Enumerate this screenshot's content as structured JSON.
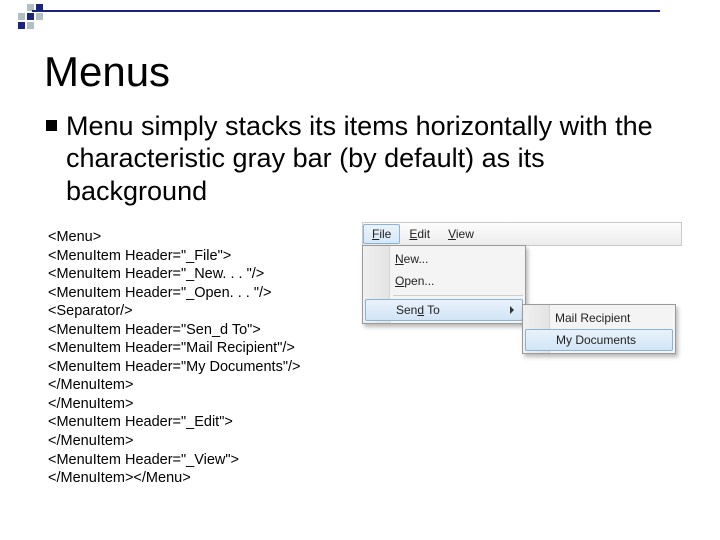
{
  "title": "Menus",
  "bullet_text": "Menu simply stacks its items horizontally with the characteristic gray bar (by default) as its background",
  "code": "<Menu>\n<MenuItem Header=\"_File\">\n<MenuItem Header=\"_New. . . \"/>\n<MenuItem Header=\"_Open. . . \"/>\n<Separator/>\n<MenuItem Header=\"Sen_d To\">\n<MenuItem Header=\"Mail Recipient\"/>\n<MenuItem Header=\"My Documents\"/>\n</MenuItem>\n</MenuItem>\n<MenuItem Header=\"_Edit\">\n</MenuItem>\n<MenuItem Header=\"_View\">\n</MenuItem></Menu>",
  "menubar": {
    "file": "File",
    "edit": "Edit",
    "view": "View"
  },
  "dropdown": {
    "new": "New...",
    "open": "Open...",
    "sendto": "Send To"
  },
  "submenu": {
    "mail": "Mail Recipient",
    "docs": "My Documents"
  }
}
